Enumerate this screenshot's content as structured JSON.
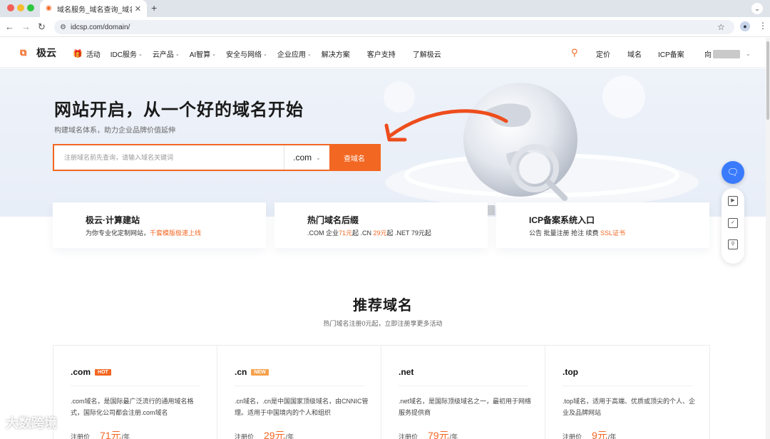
{
  "browser": {
    "tab_title": "域名服务_域名查询_域名注册",
    "url": "idcsp.com/domain/"
  },
  "header": {
    "logo_text": "极云",
    "nav": [
      {
        "label": "活动",
        "caret": false
      },
      {
        "label": "IDC服务",
        "caret": true
      },
      {
        "label": "云产品",
        "caret": true
      },
      {
        "label": "AI智算",
        "caret": true
      },
      {
        "label": "安全与网络",
        "caret": true
      },
      {
        "label": "企业应用",
        "caret": true
      },
      {
        "label": "解决方案",
        "caret": false
      },
      {
        "label": "客户支持",
        "caret": false
      },
      {
        "label": "了解极云",
        "caret": false
      }
    ],
    "right": {
      "pricing": "定价",
      "domain": "域名",
      "icp": "ICP备案",
      "user_prefix": "向"
    }
  },
  "hero": {
    "title": "网站开启，从一个好的域名开始",
    "subtitle": "构建域名体系，助力企业品牌价值延伸",
    "search_placeholder": "注册域名前先查询，请输入域名关键词",
    "suffix": ".com",
    "search_button": "查域名"
  },
  "features": [
    {
      "title": "极云·计算建站",
      "desc_plain": "为你专业化定制网站，",
      "desc_highlight": "千套模版极速上线"
    },
    {
      "title": "热门域名后缀",
      "desc_parts": [
        ".COM 企业",
        "71元",
        "起 .CN ",
        "29元",
        "起 .NET 79元起"
      ]
    },
    {
      "title": "ICP备案系统入口",
      "desc_plain": "公告 批量注册 抢注 续费 ",
      "desc_highlight": "SSL证书"
    }
  ],
  "recommend": {
    "title": "推荐域名",
    "subtitle": "热门域名注册0元起，立即注册享更多活动",
    "price_label": "注册价",
    "price_unit": "/年",
    "items": [
      {
        "name": ".com",
        "badge": "HOT",
        "desc": ".com域名，是国际最广泛流行的通用域名格式，国际化公司都会注册.com域名",
        "price": "71元"
      },
      {
        "name": ".cn",
        "badge": "NEW",
        "desc": ".cn域名，.cn是中国国家顶级域名，由CNNIC管理。适用于中国境内的个人和组织",
        "price": "29元"
      },
      {
        "name": ".net",
        "badge": "",
        "desc": ".net域名，是国际顶级域名之一，最初用于网络服务提供商",
        "price": "79元"
      },
      {
        "name": ".top",
        "badge": "",
        "desc": ".top域名，适用于高端、优质或顶尖的个人、企业及品牌网站",
        "price": "9元"
      }
    ]
  },
  "watermark": "大数跨境",
  "colors": {
    "accent": "#f26722",
    "chat_blue": "#3a7bfd"
  }
}
